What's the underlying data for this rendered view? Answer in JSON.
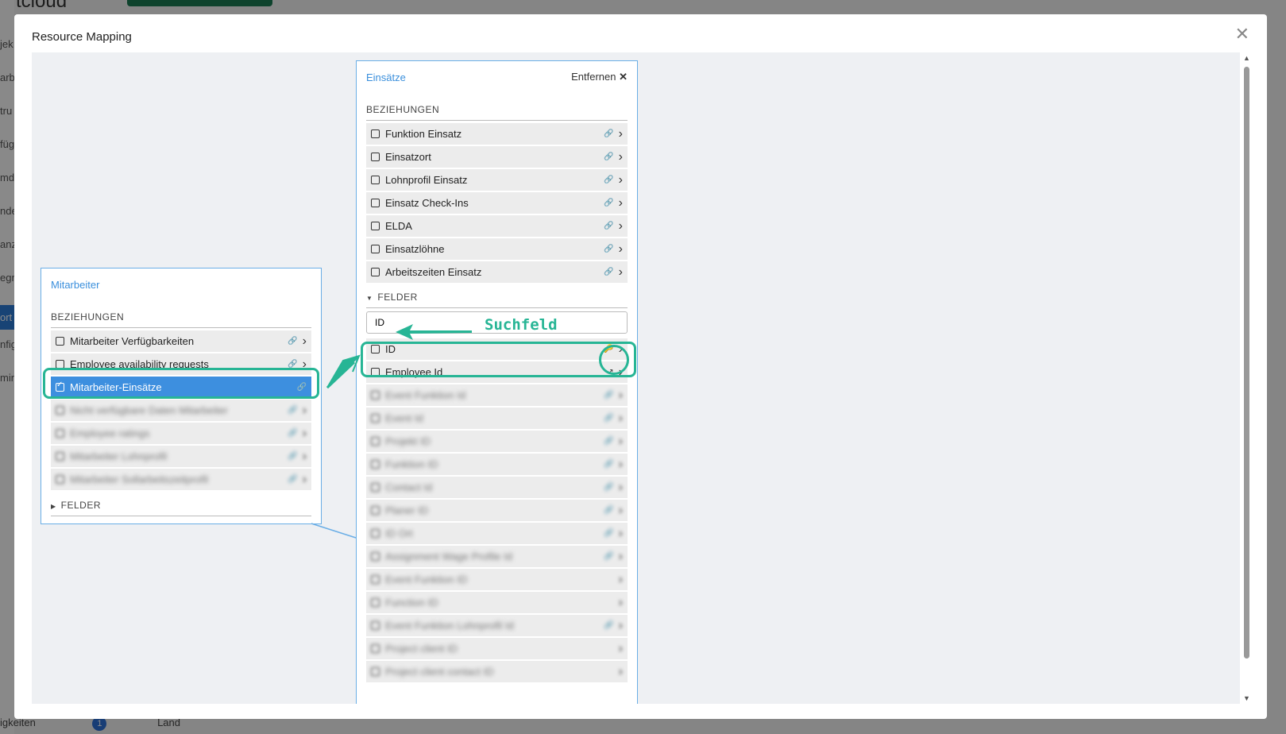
{
  "background": {
    "logo": "aftcloud",
    "sidebar_items": [
      "jek",
      "arb",
      "tru",
      "füg",
      "md",
      "nde",
      "anz",
      "egr",
      "ort",
      "nfig",
      "min"
    ],
    "bottom_left": "igkeiten",
    "badge": "1",
    "bottom_item": "Land"
  },
  "modal": {
    "title": "Resource Mapping",
    "close_icon": "close-icon"
  },
  "left_card": {
    "title": "Mitarbeiter",
    "relations_label": "BEZIEHUNGEN",
    "relations": [
      {
        "label": "Mitarbeiter Verfügbarkeiten",
        "icon": "link-icon",
        "active": false,
        "blurred": false
      },
      {
        "label": "Employee availability requests",
        "icon": "link-icon",
        "active": false,
        "blurred": false
      },
      {
        "label": "Mitarbeiter-Einsätze",
        "icon": "link-icon",
        "active": true,
        "blurred": false
      },
      {
        "label": "Nicht verfügbare Daten Mitarbeiter",
        "icon": "link-icon",
        "active": false,
        "blurred": true
      },
      {
        "label": "Employee ratings",
        "icon": "link-icon",
        "active": false,
        "blurred": true
      },
      {
        "label": "Mitarbeiter Lohnprofil",
        "icon": "link-icon",
        "active": false,
        "blurred": true
      },
      {
        "label": "Mitarbeiter Sollarbeitszeitprofil",
        "icon": "link-icon",
        "active": false,
        "blurred": true
      }
    ],
    "fields_label": "FELDER"
  },
  "right_card": {
    "title": "Einsätze",
    "remove_label": "Entfernen",
    "relations_label": "BEZIEHUNGEN",
    "relations": [
      {
        "label": "Funktion Einsatz"
      },
      {
        "label": "Einsatzort"
      },
      {
        "label": "Lohnprofil Einsatz"
      },
      {
        "label": "Einsatz Check-Ins"
      },
      {
        "label": "ELDA"
      },
      {
        "label": "Einsatzlöhne"
      },
      {
        "label": "Arbeitszeiten Einsatz"
      }
    ],
    "fields_label": "FELDER",
    "search_value": "ID",
    "fields": [
      {
        "label": "ID",
        "icon": "key-icon",
        "blurred": false
      },
      {
        "label": "Employee Id",
        "icon": "external-link-icon",
        "blurred": false
      },
      {
        "label": "Event Funktion Id",
        "icon": "link-icon",
        "blurred": true
      },
      {
        "label": "Event Id",
        "icon": "link-icon",
        "blurred": true
      },
      {
        "label": "Projekt ID",
        "icon": "link-icon",
        "blurred": true
      },
      {
        "label": "Funktion ID",
        "icon": "link-icon",
        "blurred": true
      },
      {
        "label": "Contact Id",
        "icon": "link-icon",
        "blurred": true
      },
      {
        "label": "Planer ID",
        "icon": "link-icon",
        "blurred": true
      },
      {
        "label": "ID Ort",
        "icon": "link-icon",
        "blurred": true
      },
      {
        "label": "Assignment Wage Profile Id",
        "icon": "link-icon",
        "blurred": true
      },
      {
        "label": "Event Funktion ID",
        "icon": "chevron-right-icon",
        "blurred": true
      },
      {
        "label": "Function ID",
        "icon": "chevron-right-icon",
        "blurred": true
      },
      {
        "label": "Event Funktion Lohnprofil Id",
        "icon": "link-icon",
        "blurred": true
      },
      {
        "label": "Project client ID",
        "icon": "chevron-right-icon",
        "blurred": true
      },
      {
        "label": "Project client contact ID",
        "icon": "chevron-right-icon",
        "blurred": true
      }
    ]
  },
  "annotation": {
    "label": "Suchfeld",
    "color": "#27b595"
  },
  "colors": {
    "accent": "#3d8fdf",
    "card_border": "#6aaee6",
    "annotation": "#27b595"
  }
}
